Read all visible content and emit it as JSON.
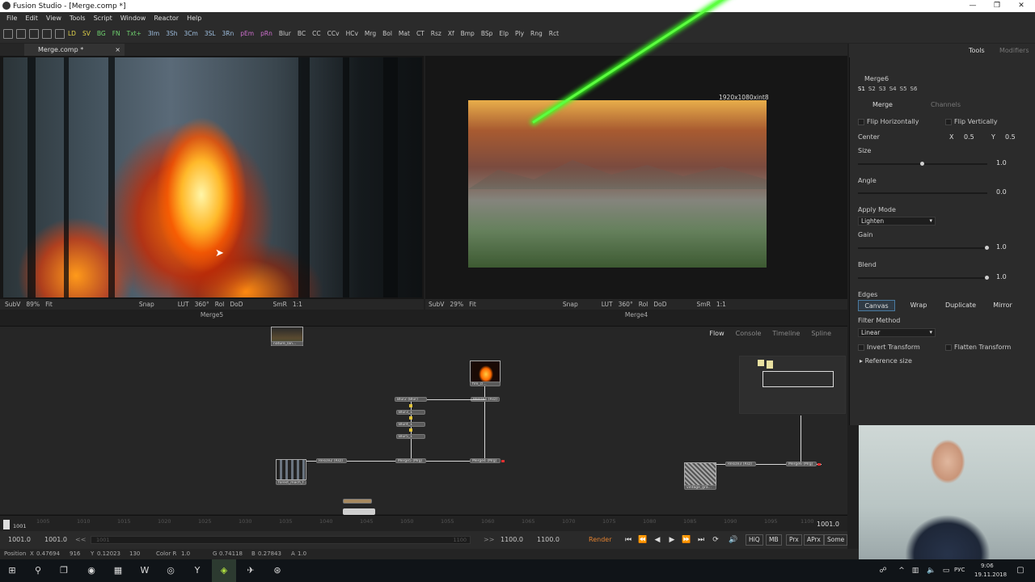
{
  "window": {
    "title": "Fusion Studio - [Merge.comp *]",
    "controls": [
      "—",
      "❐",
      "✕"
    ]
  },
  "menu": [
    "File",
    "Edit",
    "View",
    "Tools",
    "Script",
    "Window",
    "Reactor",
    "Help"
  ],
  "toolbar": [
    "LD",
    "SV",
    "BG",
    "FN",
    "Txt+",
    "3Im",
    "3Sh",
    "3Cm",
    "3SL",
    "3Rn",
    "pEm",
    "pRn",
    "Blur",
    "BC",
    "CC",
    "CCv",
    "HCv",
    "Mrg",
    "Bol",
    "Mat",
    "CT",
    "Rsz",
    "Xf",
    "Bmp",
    "BSp",
    "Elp",
    "Ply",
    "Rng",
    "Rct"
  ],
  "file_tab": {
    "label": "Merge.comp *",
    "close": "×"
  },
  "viewer_left": {
    "name": "Merge5",
    "bar": [
      "SubV",
      "89%",
      "Fit",
      "Snap",
      "LUT",
      "360°",
      "RoI",
      "DoD",
      "SmR",
      "1:1"
    ]
  },
  "viewer_right": {
    "name": "Merge4",
    "resolution": "1920x1080xint8",
    "bar": [
      "SubV",
      "29%",
      "Fit",
      "Snap",
      "LUT",
      "360°",
      "RoI",
      "DoD",
      "SmR",
      "1:1"
    ]
  },
  "flow": {
    "tabs": [
      "Flow",
      "Console",
      "Timeline",
      "Spline"
    ],
    "nodes": {
      "top_loader": "nature_lan...",
      "fire_loader": "fire_cl...",
      "resize1": "Resize1 (Rsz)",
      "blur2": "Blur2 (Blur)",
      "blur3": "Blur3_1",
      "blur4": "Blur4_1",
      "blur5": "Blur5_1",
      "forest_loader": "forest_mach_f...",
      "resize2": "Resize2 (Rsz)",
      "merge5": "Merge5 (Mrg)",
      "merge4": "Merge4 (Mrg)",
      "vintage_loader": "vintage_gra...",
      "resize3": "Resize3 (Rsz)",
      "merge6": "Merge6 (Mrg)"
    }
  },
  "timeline": {
    "ticks": [
      "1001",
      "1005",
      "1010",
      "1015",
      "1020",
      "1025",
      "1030",
      "1035",
      "1040",
      "1045",
      "1050",
      "1055",
      "1060",
      "1065",
      "1070",
      "1075",
      "1080",
      "1085",
      "1090",
      "1095",
      "1100"
    ],
    "current": "1001.0"
  },
  "transport": {
    "start": "1001.0",
    "render_start": "1001.0",
    "left_arrows": "<<",
    "range_start": "1001",
    "range_end": "1100",
    "right_arrows": ">>",
    "render_end": "1100.0",
    "end": "1100.0",
    "render_label": "Render",
    "buttons": [
      "HiQ",
      "MB",
      "Prx",
      "APrx",
      "Some"
    ]
  },
  "status": {
    "position_label": "Position",
    "x_label": "X",
    "x": "0.47694",
    "x_px": "916",
    "y_label": "Y",
    "y": "0.12023",
    "y_px": "130",
    "color_label": "Color R",
    "r": "1.0",
    "g_label": "G",
    "g": "0.74118",
    "b_label": "B",
    "b": "0.27843",
    "a_label": "A",
    "a": "1.0"
  },
  "inspector": {
    "tabs": [
      "Tools",
      "Modifiers"
    ],
    "tool_name": "Merge6",
    "slots": [
      "S1",
      "S2",
      "S3",
      "S4",
      "S5",
      "S6"
    ],
    "sub_tabs": [
      "Merge",
      "Channels"
    ],
    "flip_h": "Flip Horizontally",
    "flip_v": "Flip Vertically",
    "center_label": "Center",
    "center_x_label": "X",
    "center_x": "0.5",
    "center_y_label": "Y",
    "center_y": "0.5",
    "size_label": "Size",
    "size": "1.0",
    "size_level": 0.5,
    "angle_label": "Angle",
    "angle": "0.0",
    "apply_mode_label": "Apply Mode",
    "apply_mode": "Lighten",
    "gain_label": "Gain",
    "gain": "1.0",
    "gain_level": 1.0,
    "blend_label": "Blend",
    "blend": "1.0",
    "blend_level": 1.0,
    "edges_label": "Edges",
    "edges": [
      "Canvas",
      "Wrap",
      "Duplicate",
      "Mirror"
    ],
    "filter_label": "Filter Method",
    "filter": "Linear",
    "invert_transform": "Invert Transform",
    "flatten_transform": "Flatten Transform",
    "reference_size": "Reference size"
  },
  "taskbar": {
    "tray_lang": "РУС",
    "time": "9:06",
    "date": "19.11.2018"
  }
}
